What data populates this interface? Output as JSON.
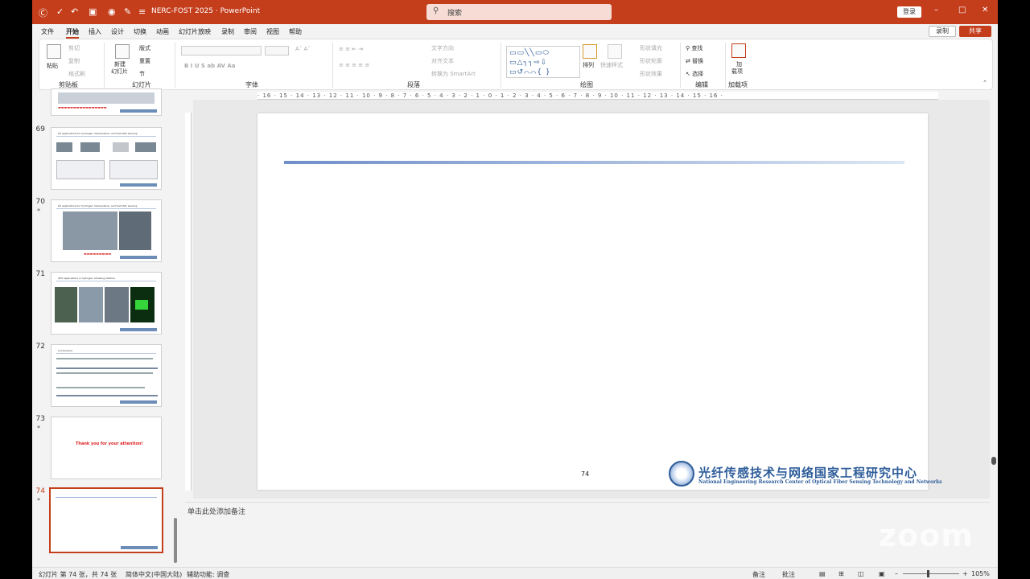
{
  "titlebar": {
    "doc_title": "NERC-FOST 2025 · PowerPoint",
    "search_placeholder": "搜索",
    "login_label": "登录",
    "minimize_glyph": "–",
    "maximize_glyph": "□",
    "close_glyph": "✕"
  },
  "menu": {
    "tabs": [
      "文件",
      "开始",
      "插入",
      "设计",
      "切换",
      "动画",
      "幻灯片放映",
      "录制",
      "审阅",
      "视图",
      "帮助"
    ],
    "active_tab": "开始",
    "record_label": "录制",
    "share_label": "共享"
  },
  "ribbon": {
    "clipboard": {
      "label": "剪贴板",
      "paste": "粘贴",
      "cut": "剪切",
      "copy": "复制",
      "format_painter": "格式刷"
    },
    "slides": {
      "label": "幻灯片",
      "new_slide": "新建",
      "new_slide2": "幻灯片",
      "layout": "版式",
      "reset": "重置",
      "section": "节"
    },
    "font": {
      "label": "字体",
      "buttons": "B  I  U  S  ab  AV  Aa"
    },
    "paragraph": {
      "label": "段落",
      "text_direction": "文字方向",
      "align_text": "对齐文本",
      "smartart": "转换为 SmartArt"
    },
    "drawing": {
      "label": "绘图",
      "arrange": "排列",
      "quick_styles": "快速样式",
      "fill": "形状填充",
      "outline": "形状轮廓",
      "effects": "形状效果",
      "shapes_glyphs": "▭▭╲╲▭⬭ ▭△┐┐⇨⇩ ▭↺⌒⌒{ }"
    },
    "editing": {
      "label": "编辑",
      "find": "查找",
      "replace": "替换",
      "select": "选择"
    },
    "addins": {
      "label": "加载项",
      "button": "加载项",
      "button_line1": "加",
      "button_line2": "载项"
    }
  },
  "slides_panel": {
    "thumbnails": [
      {
        "number": "69",
        "starred": false,
        "title": "Oil applications for hydrogen, temperature, and humidity sensing"
      },
      {
        "number": "70",
        "starred": true,
        "title": "Oil applications for hydrogen, temperature, and humidity sensing"
      },
      {
        "number": "71",
        "starred": false,
        "title": "OFS applications in hydrogen refueling stations"
      },
      {
        "number": "72",
        "starred": false,
        "title": "Conclusions"
      },
      {
        "number": "73",
        "starred": true,
        "title": "Thank you for your attention!"
      },
      {
        "number": "74",
        "starred": true,
        "title": ""
      }
    ],
    "star_glyph": "*"
  },
  "ruler": {
    "labels": "· 16 · 15 · 14 · 13 · 12 · 11 · 10 · 9 · 8 · 7 · 6 · 5 · 4 · 3 · 2 · 1 · 0 · 1 · 2 · 3 · 4 · 5 · 6 · 7 · 8 · 9 · 10 · 11 · 12 · 13 · 14 · 15 · 16 ·"
  },
  "slide": {
    "page_number": "74",
    "logo_cn": "光纤传感技术与网络国家工程研究中心",
    "logo_en": "National Engineering Research Center of Optical Fiber Sensing Technology and Networks",
    "accent_color": "#2e5d9a"
  },
  "notes": {
    "placeholder": "单击此处添加备注"
  },
  "overlay": {
    "zoom_watermark": "zoom"
  },
  "statusbar": {
    "slide_count": "幻灯片 第 74 张，共 74 张",
    "language": "简体中文(中国大陆)",
    "accessibility": "辅助功能: 调查",
    "notes_btn": "备注",
    "comments_btn": "批注",
    "zoom": "105%"
  },
  "colors": {
    "brand": "#c43e1c"
  }
}
